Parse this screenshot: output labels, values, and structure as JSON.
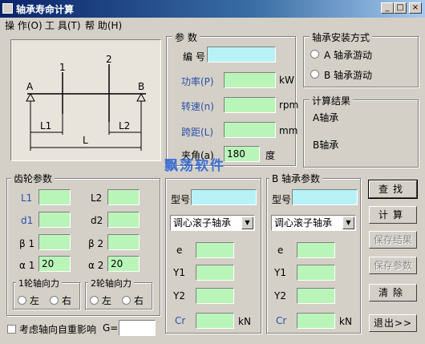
{
  "window": {
    "title": "轴承寿命计算",
    "controls": [
      "_",
      "□",
      "×"
    ]
  },
  "menu": [
    "操 作(O)",
    "工 具(T)",
    "帮 助(H)"
  ],
  "diagram": {
    "labels": {
      "a": "A",
      "b": "B",
      "n1": "1",
      "n2": "2",
      "l1": "L1",
      "l2": "L2",
      "l": "L"
    }
  },
  "params": {
    "title": "参  数",
    "code_label": "编  号",
    "power_label": "功率(P)",
    "power_unit": "kW",
    "speed_label": "转速(n)",
    "speed_unit": "rpm",
    "span_label": "跨距(L)",
    "span_unit": "mm",
    "angle_label": "夹角(a)",
    "angle_value": "180",
    "angle_unit": "度"
  },
  "mount": {
    "title": "轴承安装方式",
    "option_a": "A  轴承游动",
    "option_b": "B  轴承游动"
  },
  "results": {
    "title": "计算结果",
    "a_label": "A轴承",
    "b_label": "B轴承"
  },
  "watermark": "飘荡软件",
  "gear": {
    "title": "齿轮参数",
    "l1": "L1",
    "l2": "L2",
    "d1": "d1",
    "d2": "d2",
    "b1": "β 1",
    "b2": "β 2",
    "a1": "α 1",
    "a1_value": "20",
    "a2": "α 2",
    "a2_value": "20",
    "axial1_title": "1轮轴向力",
    "axial2_title": "2轮轴向力",
    "left": "左",
    "right": "右"
  },
  "model": {
    "label": "型号",
    "select_value": "调心滚子轴承",
    "e": "e",
    "y1": "Y1",
    "y2": "Y2",
    "cr": "Cr",
    "cr_unit": "kN"
  },
  "bparams": {
    "title": "B 轴承参数",
    "label": "型号",
    "select_value": "调心滚子轴承",
    "e": "e",
    "y1": "Y1",
    "y2": "Y2",
    "cr": "Cr",
    "cr_unit": "kN"
  },
  "buttons": {
    "search": "查找",
    "calc": "计算",
    "save_result": "保存结果",
    "save_params": "保存参数",
    "clear": "清除",
    "exit": "退出>>"
  },
  "footer": {
    "checkbox_label": "考虑轴向自重影响",
    "g_label": "G="
  }
}
